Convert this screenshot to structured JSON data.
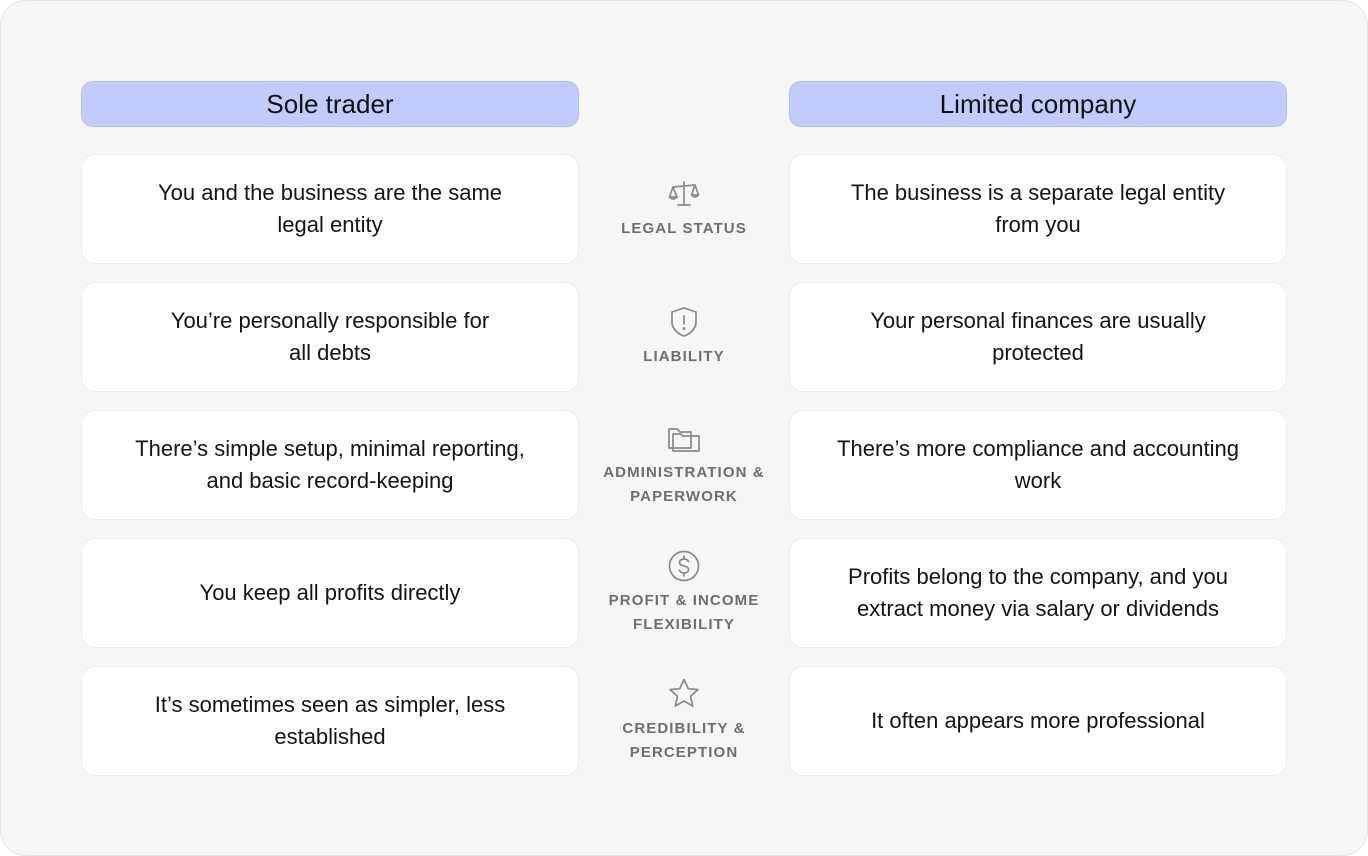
{
  "headers": {
    "left": "Sole trader",
    "right": "Limited company"
  },
  "rows": [
    {
      "icon": "scales-icon",
      "category": "LEGAL STATUS",
      "left": "You and the business are the same\nlegal entity",
      "right": "The business is a separate legal entity\nfrom you"
    },
    {
      "icon": "shield-alert-icon",
      "category": "LIABILITY",
      "left": "You’re personally responsible for\nall debts",
      "right": "Your personal finances are usually\nprotected"
    },
    {
      "icon": "folders-icon",
      "category": "ADMINISTRATION &\nPAPERWORK",
      "left": "There’s simple setup, minimal reporting,\nand basic record-keeping",
      "right": "There’s more compliance and accounting\nwork"
    },
    {
      "icon": "dollar-circle-icon",
      "category": "PROFIT & INCOME\nFLEXIBILITY",
      "left": "You keep all profits directly",
      "right": "Profits belong to the company, and you\nextract money via salary or dividends"
    },
    {
      "icon": "star-icon",
      "category": "CREDIBILITY &\nPERCEPTION",
      "left": "It’s sometimes seen as simpler, less\nestablished",
      "right": "It often appears more professional"
    }
  ],
  "colors": {
    "header_bg": "#c3cafc",
    "card_bg": "#ffffff",
    "page_bg": "#f6f6f6",
    "label_color": "#6e6e6e",
    "icon_color": "#8a8a8a"
  }
}
